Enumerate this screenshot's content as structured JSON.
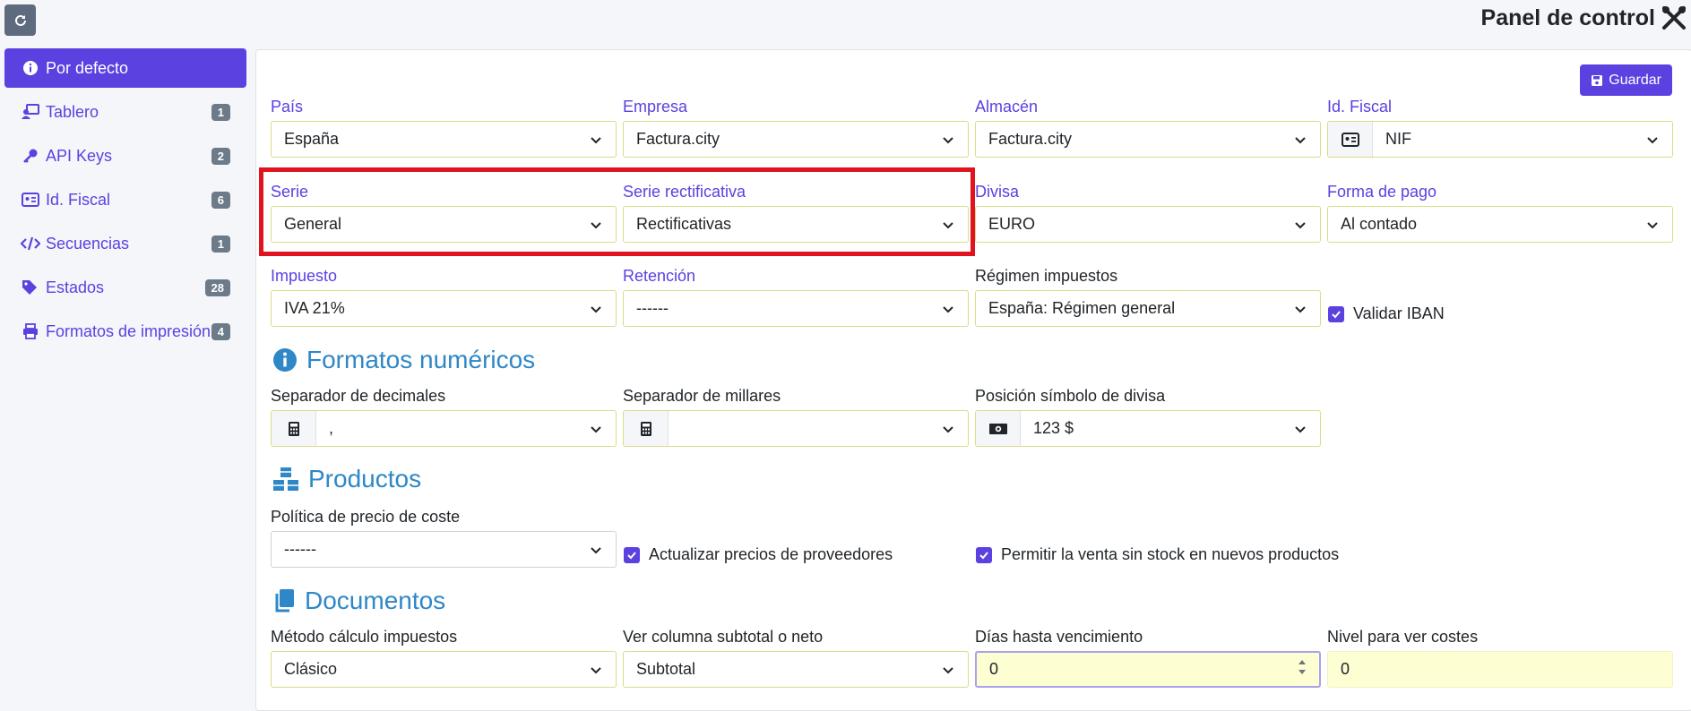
{
  "header": {
    "title": "Panel de control",
    "tools_icon": "tools-icon",
    "refresh_icon": "refresh-icon"
  },
  "sidebar": {
    "items": [
      {
        "label": "Por defecto",
        "icon": "info-icon",
        "active": true,
        "badge": ""
      },
      {
        "label": "Tablero",
        "icon": "chalkboard-user-icon",
        "badge": "1"
      },
      {
        "label": "API Keys",
        "icon": "key-icon",
        "badge": "2"
      },
      {
        "label": "Id. Fiscal",
        "icon": "id-card-icon",
        "badge": "6"
      },
      {
        "label": "Secuencias",
        "icon": "code-icon",
        "badge": "1"
      },
      {
        "label": "Estados",
        "icon": "tags-icon",
        "badge": "28"
      },
      {
        "label": "Formatos de impresión",
        "icon": "print-icon",
        "badge": "4"
      }
    ]
  },
  "toolbar": {
    "save_label": "Guardar"
  },
  "form": {
    "pais": {
      "label": "País",
      "value": "España"
    },
    "empresa": {
      "label": "Empresa",
      "value": "Factura.city"
    },
    "almacen": {
      "label": "Almacén",
      "value": "Factura.city"
    },
    "idfiscal": {
      "label": "Id. Fiscal",
      "value": "NIF"
    },
    "serie": {
      "label": "Serie",
      "value": "General"
    },
    "serie_rect": {
      "label": "Serie rectificativa",
      "value": "Rectificativas"
    },
    "divisa": {
      "label": "Divisa",
      "value": "EURO"
    },
    "forma_pago": {
      "label": "Forma de pago",
      "value": "Al contado"
    },
    "impuesto": {
      "label": "Impuesto",
      "value": "IVA 21%"
    },
    "retencion": {
      "label": "Retención",
      "value": "------"
    },
    "regimen": {
      "label": "Régimen impuestos",
      "value": "España: Régimen general"
    },
    "validar_iban": {
      "label": "Validar IBAN",
      "checked": true
    }
  },
  "numeric": {
    "title": "Formatos numéricos",
    "sep_dec": {
      "label": "Separador de decimales",
      "value": ","
    },
    "sep_mil": {
      "label": "Separador de millares",
      "value": ""
    },
    "pos_divisa": {
      "label": "Posición símbolo de divisa",
      "value": "123 $"
    }
  },
  "products": {
    "title": "Productos",
    "politica": {
      "label": "Política de precio de coste",
      "value": "------"
    },
    "actualizar": {
      "label": "Actualizar precios de proveedores",
      "checked": true
    },
    "permitir": {
      "label": "Permitir la venta sin stock en nuevos productos",
      "checked": true
    }
  },
  "documents": {
    "title": "Documentos",
    "metodo": {
      "label": "Método cálculo impuestos",
      "value": "Clásico"
    },
    "columna": {
      "label": "Ver columna subtotal o neto",
      "value": "Subtotal"
    },
    "dias": {
      "label": "Días hasta vencimiento",
      "value": "0"
    },
    "nivel": {
      "label": "Nivel para ver costes",
      "value": "0"
    }
  },
  "colors": {
    "accent": "#5b41e0",
    "section": "#2e87c7",
    "highlight": "#e0141e"
  }
}
